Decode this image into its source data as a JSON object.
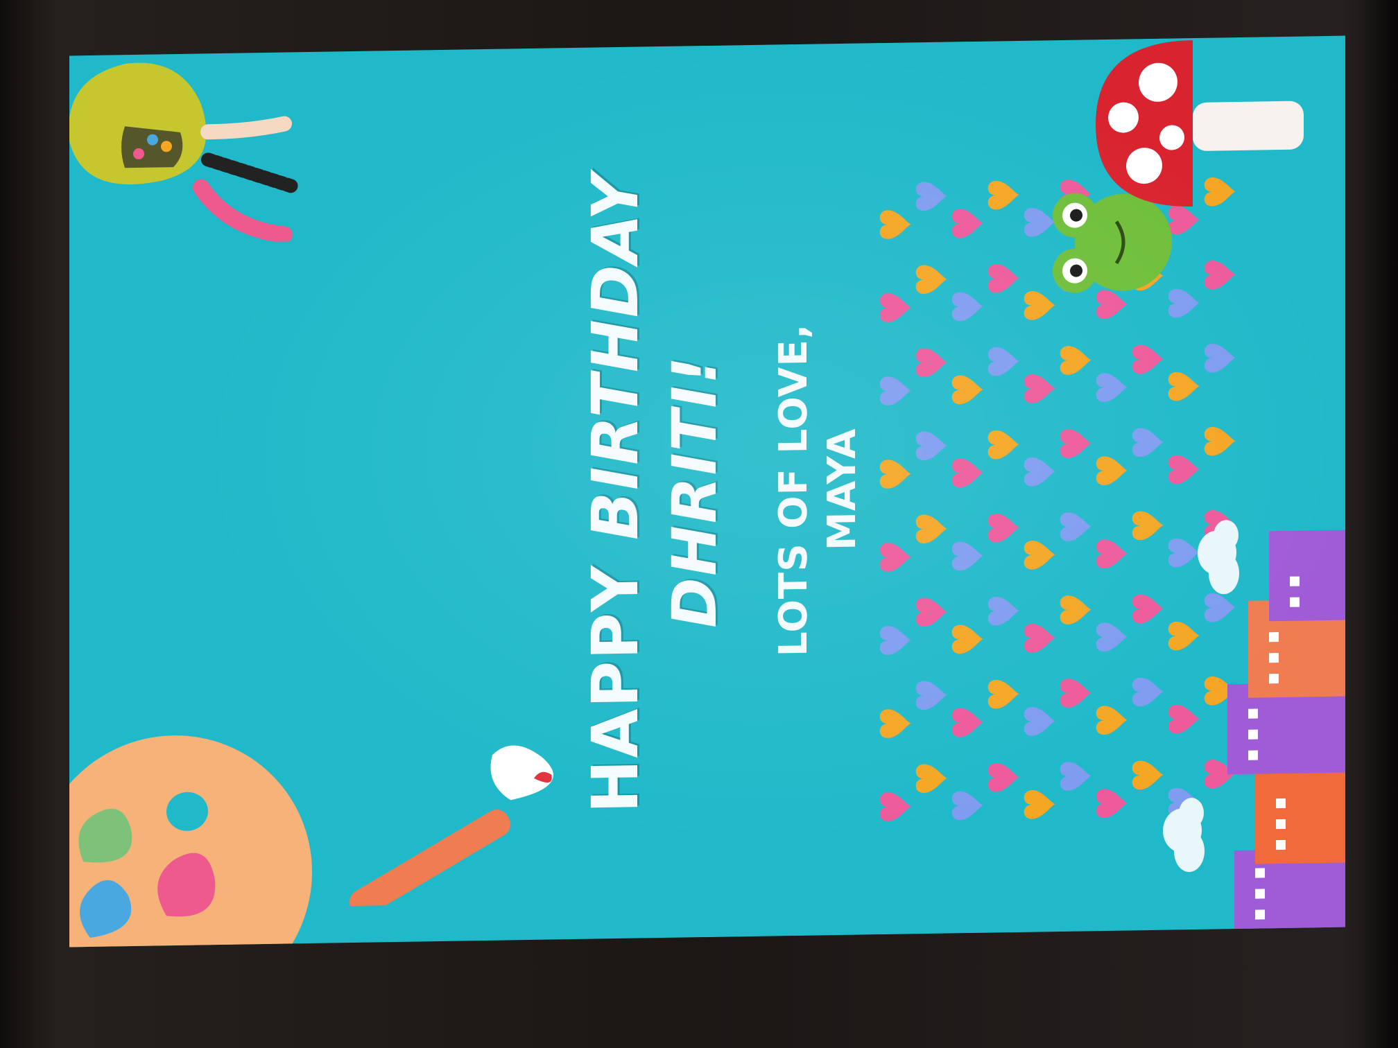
{
  "card": {
    "greeting_line1_a": "HAPPY",
    "greeting_line1_b": "BIRTHDAY",
    "recipient": "DHRITI!",
    "closing": "LOTS OF LOVE,",
    "signer": "MAYA"
  },
  "colors": {
    "background": "#1fb9c9",
    "text": "#f4fbfd",
    "heart_pink": "#ee5a9a",
    "heart_orange": "#f5a623",
    "heart_blue": "#7f9cf0",
    "palette": "#f7b27a",
    "mushroom_cap": "#d9232e"
  },
  "decorations": [
    "bird-illustration-icon",
    "paint-palette-icon",
    "paintbrush-icon",
    "cloud-icon",
    "city-buildings-icon",
    "hearts-pattern-icon",
    "frog-icon",
    "mushroom-icon"
  ]
}
